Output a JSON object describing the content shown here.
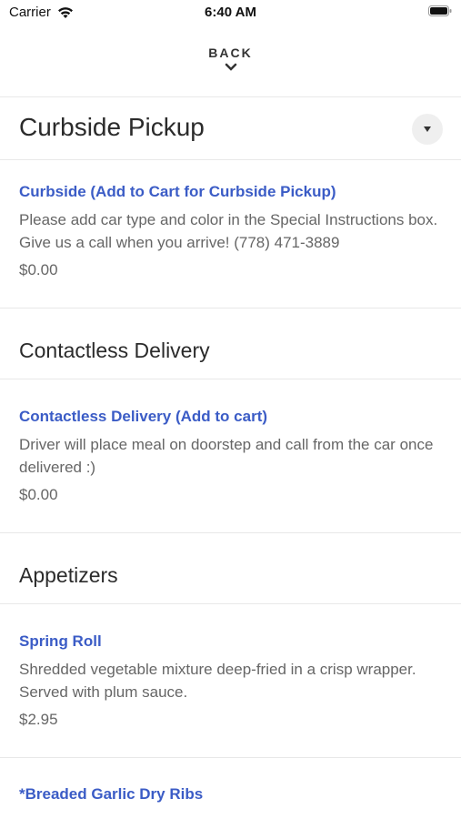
{
  "status_bar": {
    "carrier": "Carrier",
    "time": "6:40 AM"
  },
  "nav": {
    "back_label": "BACK"
  },
  "sections": [
    {
      "heading": "Curbside Pickup",
      "items": [
        {
          "title": "Curbside (Add to Cart for Curbside Pickup)",
          "description": "Please add car type and color in the Special Instructions box. Give us a call when you arrive! (778) 471-3889",
          "price": "$0.00"
        }
      ]
    },
    {
      "heading": "Contactless Delivery",
      "items": [
        {
          "title": "Contactless Delivery (Add to cart)",
          "description": "Driver will place meal on doorstep and call from the car once delivered :)",
          "price": "$0.00"
        }
      ]
    },
    {
      "heading": "Appetizers",
      "items": [
        {
          "title": "Spring Roll",
          "description": "Shredded vegetable mixture deep-fried in a crisp wrapper. Served with plum sauce.",
          "price": "$2.95"
        },
        {
          "title": "*Breaded Garlic Dry Ribs"
        }
      ]
    }
  ],
  "icons": {
    "wifi": "wifi-icon",
    "battery": "battery-icon",
    "back": "chevron-down-icon",
    "dropdown": "caret-down-icon"
  },
  "colors": {
    "link": "#3b5cc6",
    "text": "#2b2b2b",
    "muted": "#666666",
    "divider": "#e8e8e8"
  }
}
